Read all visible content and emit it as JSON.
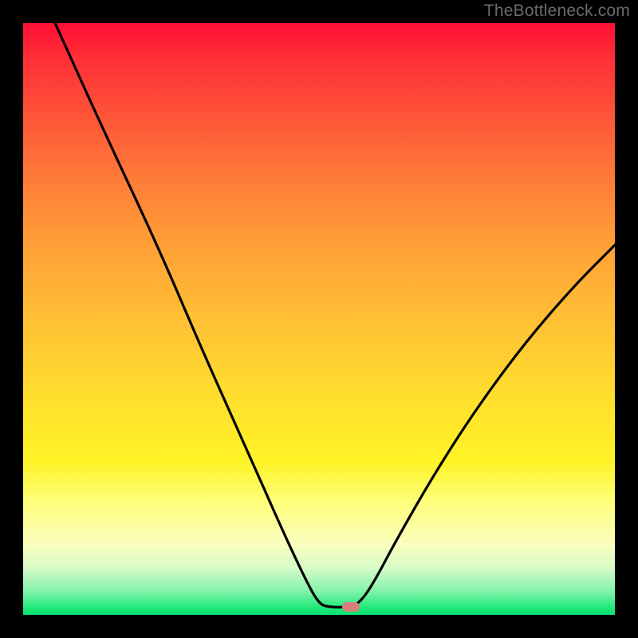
{
  "watermark": "TheBottleneck.com",
  "chart_data": {
    "type": "line",
    "title": "",
    "xlabel": "",
    "ylabel": "",
    "xlim": [
      0,
      100
    ],
    "ylim": [
      0,
      100
    ],
    "grid": false,
    "legend": false,
    "note": "x/y expressed as percentages of inner plot width/height with y measured from the bottom (0 = bottom, 100 = top)",
    "series": [
      {
        "name": "curve",
        "points": [
          {
            "x": 5.4,
            "y": 100.0
          },
          {
            "x": 14.0,
            "y": 81.0
          },
          {
            "x": 22.9,
            "y": 62.0
          },
          {
            "x": 30.8,
            "y": 43.5
          },
          {
            "x": 38.0,
            "y": 27.5
          },
          {
            "x": 43.5,
            "y": 15.0
          },
          {
            "x": 47.7,
            "y": 6.0
          },
          {
            "x": 49.9,
            "y": 2.0
          },
          {
            "x": 51.5,
            "y": 1.3
          },
          {
            "x": 55.1,
            "y": 1.3
          },
          {
            "x": 56.8,
            "y": 2.0
          },
          {
            "x": 59.0,
            "y": 5.0
          },
          {
            "x": 63.0,
            "y": 12.5
          },
          {
            "x": 69.0,
            "y": 23.0
          },
          {
            "x": 76.0,
            "y": 34.0
          },
          {
            "x": 84.4,
            "y": 45.5
          },
          {
            "x": 93.0,
            "y": 55.5
          },
          {
            "x": 100.0,
            "y": 62.5
          }
        ]
      }
    ],
    "marker": {
      "x": 55.4,
      "y": 1.35
    },
    "colors": {
      "curve": "#000000",
      "marker_fill": "#d77f7e",
      "bg_top": "#fe1035",
      "bg_bottom": "#0ae170"
    }
  }
}
